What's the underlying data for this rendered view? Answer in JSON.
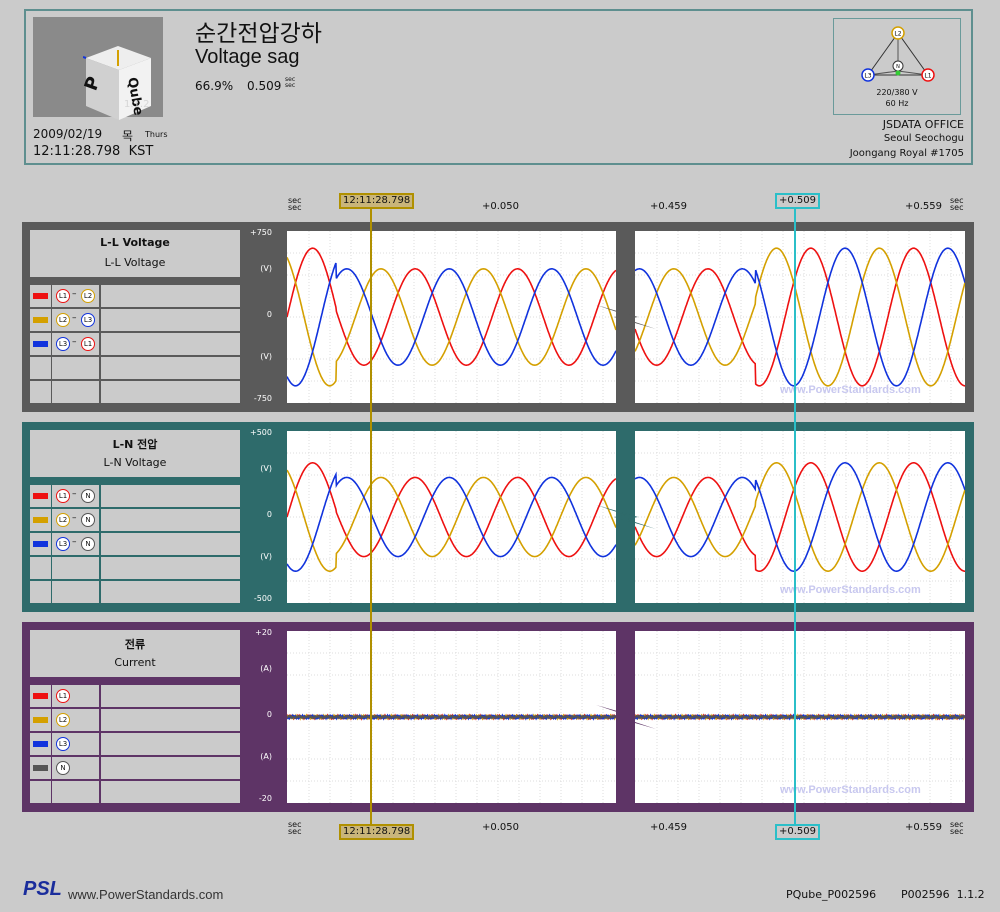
{
  "header": {
    "logo_version": "1.1.2",
    "title_ko": "순간전압강하",
    "title_en": "Voltage sag",
    "sag_depth": "66.9%",
    "sag_duration": "0.509",
    "sag_duration_unit_1": "sec",
    "sag_duration_unit_2": "sec",
    "date": "2009/02/19",
    "day_ko": "목",
    "day_en": "Thurs",
    "time": "12:11:28.798  KST",
    "system_voltage": "220/380 V",
    "system_frequency": "60 Hz",
    "diagram_labels": {
      "l1": "L1",
      "l2": "L2",
      "l3": "L3",
      "n": "N"
    },
    "location_name": "JSDATA OFFICE",
    "location_city": "Seoul Seochogu",
    "location_building": "Joongang Royal #1705"
  },
  "time_axis": {
    "unit_1": "sec",
    "unit_2": "sec",
    "cursor1_label": "12:11:28.798",
    "tick1": "+0.050",
    "tick2": "+0.459",
    "cursor2_label": "+0.509",
    "tick3": "+0.559"
  },
  "colors": {
    "l1": "#ee1111",
    "l2": "#d4a000",
    "l3": "#1133dd",
    "n": "#555555",
    "ll_frame": "#5a5a5a",
    "ln_frame": "#2e6b6b",
    "current_frame": "#5e3466"
  },
  "panels": {
    "ll": {
      "title_1": "L-L Voltage",
      "title_2": "L-L Voltage",
      "legend": [
        {
          "a": "L1",
          "b": "L2"
        },
        {
          "a": "L2",
          "b": "L3"
        },
        {
          "a": "L3",
          "b": "L1"
        }
      ],
      "y_top": "+750",
      "y_unit_top": "(V)",
      "y_zero": "0",
      "y_unit_bot": "(V)",
      "y_bot": "-750",
      "watermark": "www.PowerStandards.com"
    },
    "ln": {
      "title_1": "L-N 전압",
      "title_2": "L-N Voltage",
      "legend": [
        {
          "a": "L1",
          "b": "N"
        },
        {
          "a": "L2",
          "b": "N"
        },
        {
          "a": "L3",
          "b": "N"
        }
      ],
      "y_top": "+500",
      "y_unit_top": "(V)",
      "y_zero": "0",
      "y_unit_bot": "(V)",
      "y_bot": "-500",
      "watermark": "www.PowerStandards.com"
    },
    "cur": {
      "title_1": "전류",
      "title_2": "Current",
      "legend": [
        {
          "a": "L1"
        },
        {
          "a": "L2"
        },
        {
          "a": "L3"
        },
        {
          "a": "N"
        }
      ],
      "y_top": "+20",
      "y_unit_top": "(A)",
      "y_zero": "0",
      "y_unit_bot": "(A)",
      "y_bot": "-20",
      "watermark": "www.PowerStandards.com"
    }
  },
  "chart_data": [
    {
      "type": "line",
      "title": "L-L Voltage",
      "ylabel": "(V)",
      "ylim": [
        -750,
        750
      ],
      "xlabel": "sec",
      "x_ticks": [
        "12:11:28.798",
        "+0.050",
        "+0.459",
        "+0.509",
        "+0.559"
      ],
      "series": [
        {
          "name": "L1-L2",
          "amplitude_normal": 600,
          "amplitude_sag": 420,
          "amplitude_recovered": 600,
          "frequency_hz": 60
        },
        {
          "name": "L2-L3",
          "amplitude_normal": 600,
          "amplitude_sag": 420,
          "amplitude_recovered": 600,
          "frequency_hz": 60
        },
        {
          "name": "L3-L1",
          "amplitude_normal": 600,
          "amplitude_sag": 420,
          "amplitude_recovered": 600,
          "frequency_hz": 60
        }
      ]
    },
    {
      "type": "line",
      "title": "L-N Voltage",
      "ylabel": "(V)",
      "ylim": [
        -500,
        500
      ],
      "xlabel": "sec",
      "series": [
        {
          "name": "L1-N",
          "amplitude_normal": 315,
          "amplitude_sag": 230,
          "amplitude_recovered": 315,
          "frequency_hz": 60
        },
        {
          "name": "L2-N",
          "amplitude_normal": 315,
          "amplitude_sag": 230,
          "amplitude_recovered": 315,
          "frequency_hz": 60
        },
        {
          "name": "L3-N",
          "amplitude_normal": 315,
          "amplitude_sag": 230,
          "amplitude_recovered": 315,
          "frequency_hz": 60
        }
      ]
    },
    {
      "type": "line",
      "title": "Current",
      "ylabel": "(A)",
      "ylim": [
        -20,
        20
      ],
      "xlabel": "sec",
      "series": [
        {
          "name": "L1",
          "amplitude": 0.4
        },
        {
          "name": "L2",
          "amplitude": 0.4
        },
        {
          "name": "L3",
          "amplitude": 0.4
        },
        {
          "name": "N",
          "amplitude": 0.3
        }
      ]
    }
  ],
  "footer": {
    "logo": "PSL",
    "url": "www.PowerStandards.com",
    "device": "PQube_P002596",
    "serial": "P002596  1.1.2"
  }
}
